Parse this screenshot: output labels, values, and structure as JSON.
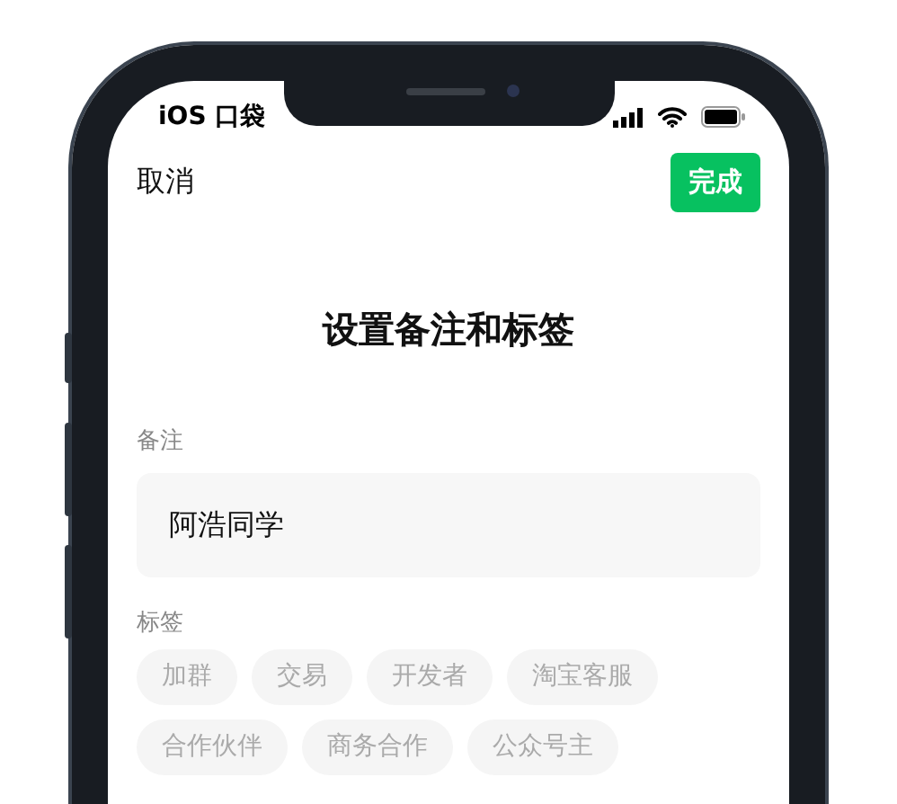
{
  "status_bar": {
    "carrier": "iOS 口袋"
  },
  "nav": {
    "cancel": "取消",
    "done": "完成"
  },
  "title": "设置备注和标签",
  "remark": {
    "label": "备注",
    "value": "阿浩同学"
  },
  "tags": {
    "label": "标签",
    "items": [
      {
        "label": "加群"
      },
      {
        "label": "交易"
      },
      {
        "label": "开发者"
      },
      {
        "label": "淘宝客服"
      },
      {
        "label": "合作伙伴"
      },
      {
        "label": "商务合作"
      },
      {
        "label": "公众号主"
      }
    ]
  }
}
